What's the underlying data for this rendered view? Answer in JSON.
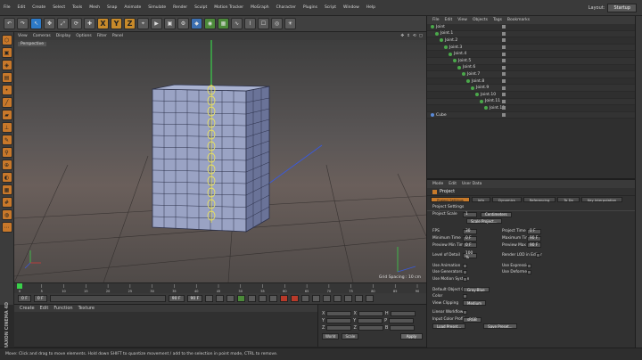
{
  "menubar": {
    "items": [
      "File",
      "Edit",
      "Create",
      "Select",
      "Tools",
      "Mesh",
      "Snap",
      "Animate",
      "Simulate",
      "Render",
      "Sculpt",
      "Motion Tracker",
      "MoGraph",
      "Character",
      "Plugins",
      "Script",
      "Window",
      "Help"
    ],
    "layout_label": "Layout:",
    "layout_value": "Startup"
  },
  "toolbar": {
    "x_label": "X",
    "y_label": "Y",
    "z_label": "Z"
  },
  "viewport": {
    "menu": [
      "View",
      "Cameras",
      "Display",
      "Options",
      "Filter",
      "Panel"
    ],
    "perspective_label": "Perspective",
    "grid_spacing": "Grid Spacing : 10 cm"
  },
  "timeline": {
    "ticks": [
      "0",
      "5",
      "10",
      "15",
      "20",
      "25",
      "30",
      "35",
      "40",
      "45",
      "50",
      "55",
      "60",
      "65",
      "70",
      "75",
      "80",
      "85",
      "90"
    ],
    "frame_indicator": "0 F"
  },
  "playbar": {
    "start": "0 F",
    "current": "0 F",
    "end": "90 F",
    "end2": "90 F"
  },
  "material_manager": {
    "menu": [
      "Create",
      "Edit",
      "Function",
      "Texture"
    ]
  },
  "coordinates": {
    "rows": [
      {
        "a": "X",
        "av": "0 cm",
        "b": "X",
        "bv": "0 cm",
        "c": "H",
        "cv": "0 °"
      },
      {
        "a": "Y",
        "av": "0 cm",
        "b": "Y",
        "bv": "0 cm",
        "c": "P",
        "cv": "0 °"
      },
      {
        "a": "Z",
        "av": "0 cm",
        "b": "Z",
        "bv": "0 cm",
        "c": "B",
        "cv": "0 °"
      }
    ],
    "mode": "World",
    "size_mode": "Scale",
    "apply_label": "Apply"
  },
  "logo": {
    "text": "MAXON CINEMA 4D"
  },
  "status": {
    "text": "Move: Click and drag to move elements. Hold down SHIFT to quantize movement / add to the selection in point mode, CTRL to remove."
  },
  "object_manager": {
    "menu": [
      "File",
      "Edit",
      "View",
      "Objects",
      "Tags",
      "Bookmarks"
    ],
    "objects": [
      {
        "name": "Joint",
        "indent": 0
      },
      {
        "name": "Joint.1",
        "indent": 1
      },
      {
        "name": "Joint.2",
        "indent": 2
      },
      {
        "name": "Joint.3",
        "indent": 3
      },
      {
        "name": "Joint.4",
        "indent": 4
      },
      {
        "name": "Joint.5",
        "indent": 5
      },
      {
        "name": "Joint.6",
        "indent": 6
      },
      {
        "name": "Joint.7",
        "indent": 7
      },
      {
        "name": "Joint.8",
        "indent": 8
      },
      {
        "name": "Joint.9",
        "indent": 9
      },
      {
        "name": "Joint.10",
        "indent": 10
      },
      {
        "name": "Joint.11",
        "indent": 11
      },
      {
        "name": "Joint.12",
        "indent": 12
      },
      {
        "name": "Cube",
        "indent": 0
      }
    ]
  },
  "attribute_manager": {
    "menu": [
      "Mode",
      "Edit",
      "User Data"
    ],
    "title": "Project",
    "tabs": [
      "Project Settings",
      "Info",
      "Dynamics",
      "Referencing",
      "To Do",
      "Key Interpolation"
    ],
    "section": "Project Settings",
    "project_scale_label": "Project Scale",
    "project_scale_value": "1",
    "project_scale_unit": "Centimeters",
    "scale_project_btn": "Scale Project...",
    "fps_label": "FPS",
    "fps_value": "30",
    "project_time_label": "Project Time",
    "project_time_value": "0 F",
    "min_time_label": "Minimum Time",
    "min_time_value": "0 F",
    "max_time_label": "Maximum Time",
    "max_time_value": "90 F",
    "prev_min_label": "Preview Min Time",
    "prev_min_value": "0 F",
    "prev_max_label": "Preview Max Time",
    "prev_max_value": "90 F",
    "lod_label": "Level of Detail",
    "lod_value": "100 %",
    "render_lod_label": "Render LOD in Editor",
    "use_anim_label": "Use Animation",
    "use_expr_label": "Use Expression",
    "use_gen_label": "Use Generators",
    "use_deform_label": "Use Deformers",
    "use_motion_label": "Use Motion System",
    "default_color_label": "Default Object Color",
    "default_color_value": "Gray-Blue",
    "color_label": "Color",
    "view_clip_label": "View Clipping",
    "view_clip_value": "Medium",
    "linear_wf_label": "Linear Workflow",
    "input_profile_label": "Input Color Profile",
    "input_profile_value": "sRGB",
    "load_preset_btn": "Load Preset...",
    "save_preset_btn": "Save Preset..."
  }
}
